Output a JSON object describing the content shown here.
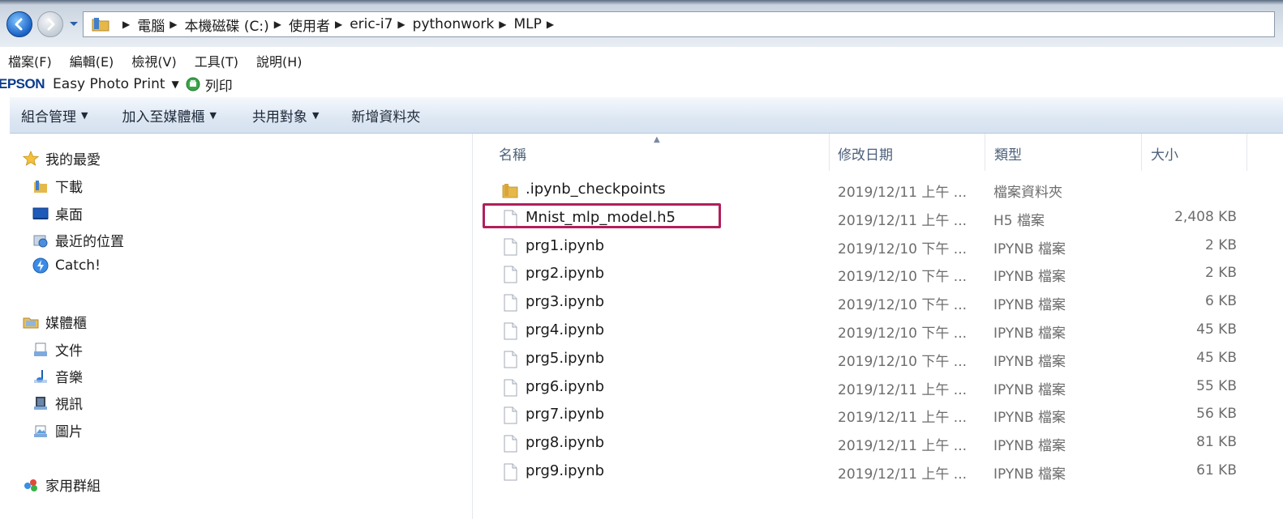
{
  "address": {
    "crumbs": [
      "電腦",
      "本機磁碟 (C:)",
      "使用者",
      "eric-i7",
      "pythonwork",
      "MLP"
    ]
  },
  "menu": {
    "items": [
      "檔案(F)",
      "編輯(E)",
      "檢視(V)",
      "工具(T)",
      "說明(H)"
    ]
  },
  "epson": {
    "logo": "EPSON",
    "app_name": "Easy Photo Print",
    "print_label": "列印"
  },
  "commands": {
    "organize": "組合管理",
    "add_to_library": "加入至媒體櫃",
    "share_with": "共用對象",
    "new_folder": "新增資料夾"
  },
  "nav": {
    "favorites": {
      "label": "我的最愛",
      "items": [
        "下載",
        "桌面",
        "最近的位置",
        "Catch!"
      ]
    },
    "libraries": {
      "label": "媒體櫃",
      "items": [
        "文件",
        "音樂",
        "視訊",
        "圖片"
      ]
    },
    "homegroup": {
      "label": "家用群組"
    }
  },
  "columns": {
    "name": "名稱",
    "date": "修改日期",
    "type": "類型",
    "size": "大小"
  },
  "files": [
    {
      "name": ".ipynb_checkpoints",
      "date": "2019/12/11 上午 ...",
      "type": "檔案資料夾",
      "size": "",
      "icon": "folder-icon"
    },
    {
      "name": "Mnist_mlp_model.h5",
      "date": "2019/12/11 上午 ...",
      "type": "H5 檔案",
      "size": "2,408 KB",
      "icon": "file-icon",
      "highlighted": true
    },
    {
      "name": "prg1.ipynb",
      "date": "2019/12/10 下午 ...",
      "type": "IPYNB 檔案",
      "size": "2 KB",
      "icon": "file-icon"
    },
    {
      "name": "prg2.ipynb",
      "date": "2019/12/10 下午 ...",
      "type": "IPYNB 檔案",
      "size": "2 KB",
      "icon": "file-icon"
    },
    {
      "name": "prg3.ipynb",
      "date": "2019/12/10 下午 ...",
      "type": "IPYNB 檔案",
      "size": "6 KB",
      "icon": "file-icon"
    },
    {
      "name": "prg4.ipynb",
      "date": "2019/12/10 下午 ...",
      "type": "IPYNB 檔案",
      "size": "45 KB",
      "icon": "file-icon"
    },
    {
      "name": "prg5.ipynb",
      "date": "2019/12/10 下午 ...",
      "type": "IPYNB 檔案",
      "size": "45 KB",
      "icon": "file-icon"
    },
    {
      "name": "prg6.ipynb",
      "date": "2019/12/11 上午 ...",
      "type": "IPYNB 檔案",
      "size": "55 KB",
      "icon": "file-icon"
    },
    {
      "name": "prg7.ipynb",
      "date": "2019/12/11 上午 ...",
      "type": "IPYNB 檔案",
      "size": "56 KB",
      "icon": "file-icon"
    },
    {
      "name": "prg8.ipynb",
      "date": "2019/12/11 上午 ...",
      "type": "IPYNB 檔案",
      "size": "81 KB",
      "icon": "file-icon"
    },
    {
      "name": "prg9.ipynb",
      "date": "2019/12/11 上午 ...",
      "type": "IPYNB 檔案",
      "size": "61 KB",
      "icon": "file-icon"
    }
  ],
  "colors": {
    "highlight_border": "#b11f5c",
    "epson_blue": "#0b3c8c",
    "header_text": "#4c607a"
  }
}
